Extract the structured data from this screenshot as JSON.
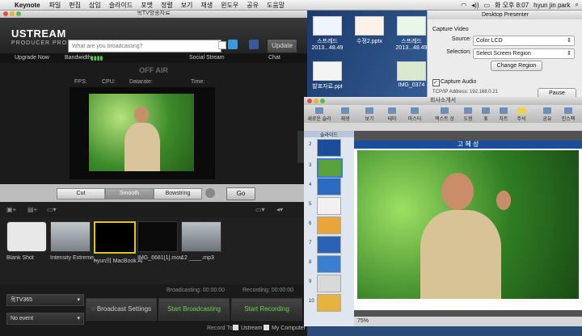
{
  "menubar": {
    "app": "Keynote",
    "items": [
      "파일",
      "편집",
      "삽입",
      "슬라이드",
      "포맷",
      "정렬",
      "보기",
      "재생",
      "윈도우",
      "공유",
      "도움말"
    ],
    "clock": "화 오후 8:07",
    "user": "hyun jin park"
  },
  "desktop": {
    "icons": [
      {
        "label": "스프레드 2013...48.49"
      },
      {
        "label": "수정2.pptx"
      },
      {
        "label": "스프레드 2013...48.49"
      },
      {
        "label": "발표자료.ppt"
      },
      {
        "label": "IMG_0374"
      }
    ]
  },
  "ustream": {
    "window_title": "목TV방송자료",
    "logo": "USTREAM",
    "logo_sub": "PRODUCER PRO",
    "status_placeholder": "What are you broadcasting?",
    "update_label": "Update",
    "nav": {
      "upgrade": "Upgrade Now",
      "bandwidth": "Bandwidth",
      "social": "Social Stream",
      "chat": "Chat"
    },
    "offair": "OFF AIR",
    "stats": {
      "fps": "FPS:",
      "cpu": "CPU:",
      "datarate": "Datarate:",
      "time": "Time:"
    },
    "transitions": {
      "cut": "Cut",
      "smooth": "Smooth",
      "bowstring": "Bowstring",
      "go": "Go"
    },
    "sources": [
      {
        "label": "Blank Shot",
        "color": "#e8e8e8"
      },
      {
        "label": "Intensity Extreme_",
        "color": "#9aa2a8"
      },
      {
        "label": "hyun의 MacBook Ai",
        "color": "#000000"
      },
      {
        "label": "IMG_6681[1].mov",
        "color": "#0a0a0a"
      },
      {
        "label": "12 ____.mp3",
        "color": "#8a9096"
      }
    ],
    "broadcasting_time": "Broadcasting: 00:00:00",
    "recording_time": "Recording: 00:00:00",
    "channel": "목TV365",
    "event": "No event",
    "broadcast_settings": "Broadcast Settings",
    "start_broadcasting": "Start Broadcasting",
    "start_recording": "Start Recording",
    "record_to": "Record To:",
    "record_ustream": "Ustream",
    "record_computer": "My Computer"
  },
  "presenter": {
    "title": "Desktop Presenter",
    "capture_video": "Capture Video",
    "source_label": "Source:",
    "source_value": "Color LCD",
    "selection_label": "Selection:",
    "selection_value": "Select Screen Region",
    "change_region": "Change Region",
    "capture_audio": "Capture Audio",
    "tcp": "TCP/IP Address: 192.168.0.21",
    "pause": "Pause"
  },
  "keynote": {
    "title": "회사소개서",
    "toolbar": [
      "새로운 슬라이드",
      "재생",
      "보기",
      "테마",
      "마스터",
      "텍스트 상자",
      "도형",
      "표",
      "차트",
      "주석",
      "공유",
      "인스펙터",
      "미디어"
    ],
    "nav_header": "슬라이드",
    "slide_title": "고 혜 성",
    "zoom": "75%",
    "slide_numbers": [
      "2",
      "3",
      "4",
      "5",
      "6",
      "7",
      "8",
      "9",
      "10"
    ]
  }
}
